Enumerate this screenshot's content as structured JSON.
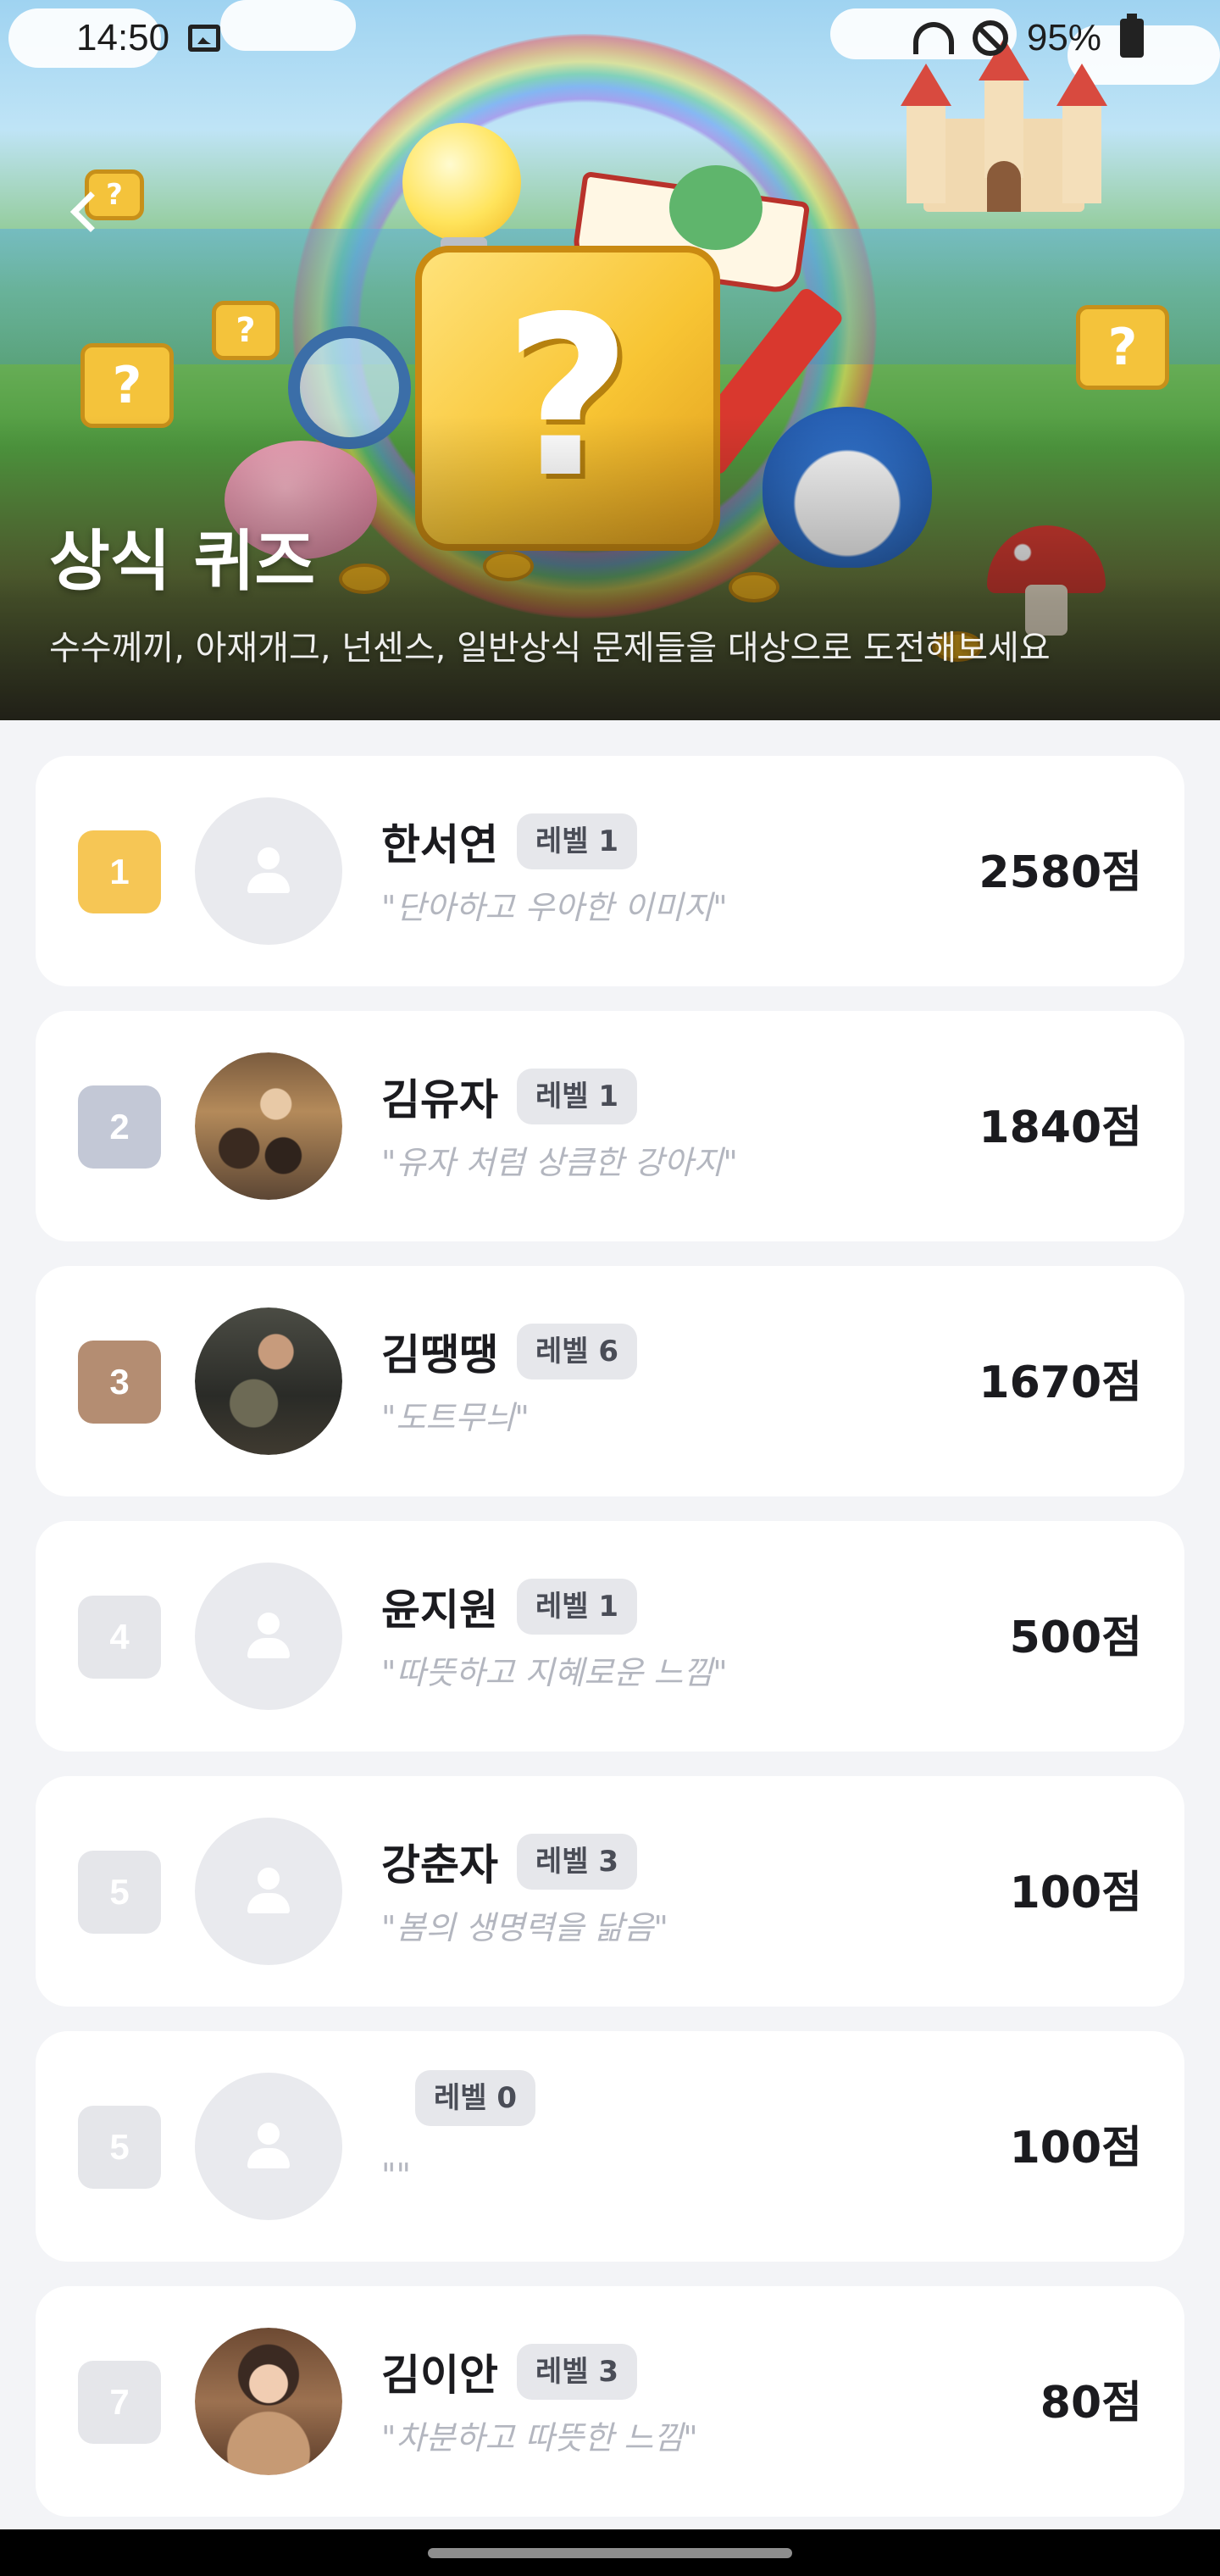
{
  "status_bar": {
    "time": "14:50",
    "battery": "95%",
    "icons": [
      "image-icon",
      "wifi-icon",
      "do-not-disturb-icon",
      "battery-charging-icon"
    ]
  },
  "header": {
    "title": "상식 퀴즈",
    "subtitle": "수수께끼, 아재개그, 넌센스, 일반상식 문제들을 대상으로 도전해보세요",
    "back_icon": "chevron-left-icon"
  },
  "colors": {
    "rank_gold": "#f6c655",
    "rank_silver": "#c3c8d6",
    "rank_bronze": "#b48d72",
    "rank_default": "#e5e6ea"
  },
  "ranking": [
    {
      "rank": "1",
      "name": "한서연",
      "level": "레벨 1",
      "motto": "\"단아하고 우아한 이미지\"",
      "score": "2580점",
      "avatar": "default"
    },
    {
      "rank": "2",
      "name": "김유자",
      "level": "레벨 1",
      "motto": "\"유자 처럼 상큼한 강아지\"",
      "score": "1840점",
      "avatar": "photo"
    },
    {
      "rank": "3",
      "name": "김땡땡",
      "level": "레벨 6",
      "motto": "\"도트무늬\"",
      "score": "1670점",
      "avatar": "photo"
    },
    {
      "rank": "4",
      "name": "윤지원",
      "level": "레벨 1",
      "motto": "\"따뜻하고 지혜로운 느낌\"",
      "score": "500점",
      "avatar": "default"
    },
    {
      "rank": "5",
      "name": "강춘자",
      "level": "레벨 3",
      "motto": "\"봄의 생명력을 닮음\"",
      "score": "100점",
      "avatar": "default"
    },
    {
      "rank": "5",
      "name": "",
      "level": "레벨 0",
      "motto": "\"\"",
      "score": "100점",
      "avatar": "default"
    },
    {
      "rank": "7",
      "name": "김이안",
      "level": "레벨 3",
      "motto": "\"차분하고 따뜻한 느낌\"",
      "score": "80점",
      "avatar": "photo"
    }
  ]
}
